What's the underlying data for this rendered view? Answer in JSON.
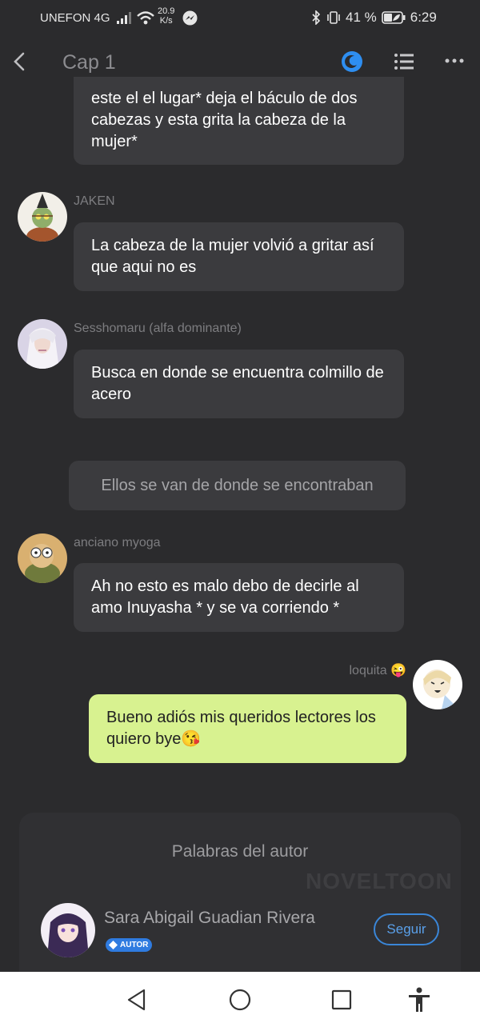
{
  "status_bar": {
    "carrier": "UNEFON 4G",
    "speed_value": "20.9",
    "speed_unit": "K/s",
    "battery": "41 %",
    "time": "6:29"
  },
  "header": {
    "title": "Cap 1"
  },
  "messages": [
    {
      "text": "este el el lugar* deja el báculo de dos cabezas y esta grita la cabeza de la mujer*"
    },
    {
      "sender": "JAKEN",
      "text": "La cabeza de la mujer volvió a gritar así que aqui no es"
    },
    {
      "sender": "Sesshomaru (alfa dominante)",
      "text": "Busca en donde se encuentra colmillo de acero"
    },
    {
      "narration": "Ellos se van de donde se encontraban"
    },
    {
      "sender": "anciano myoga",
      "text": "Ah no esto es malo debo de decirle al amo Inuyasha * y se va corriendo *"
    },
    {
      "sender": "loquita 😜",
      "text": "Bueno adiós mis queridos lectores los quiero bye😘"
    }
  ],
  "author_card": {
    "heading": "Palabras del autor",
    "watermark": "NOVELTOON",
    "author_name": "Sara Abigail Guadian Rivera",
    "badge": "AUTOR",
    "follow_label": "Seguir"
  },
  "colors": {
    "background": "#2b2b2d",
    "bubble": "#3b3b3e",
    "my_bubble": "#d8f290",
    "accent": "#3a86d8"
  }
}
